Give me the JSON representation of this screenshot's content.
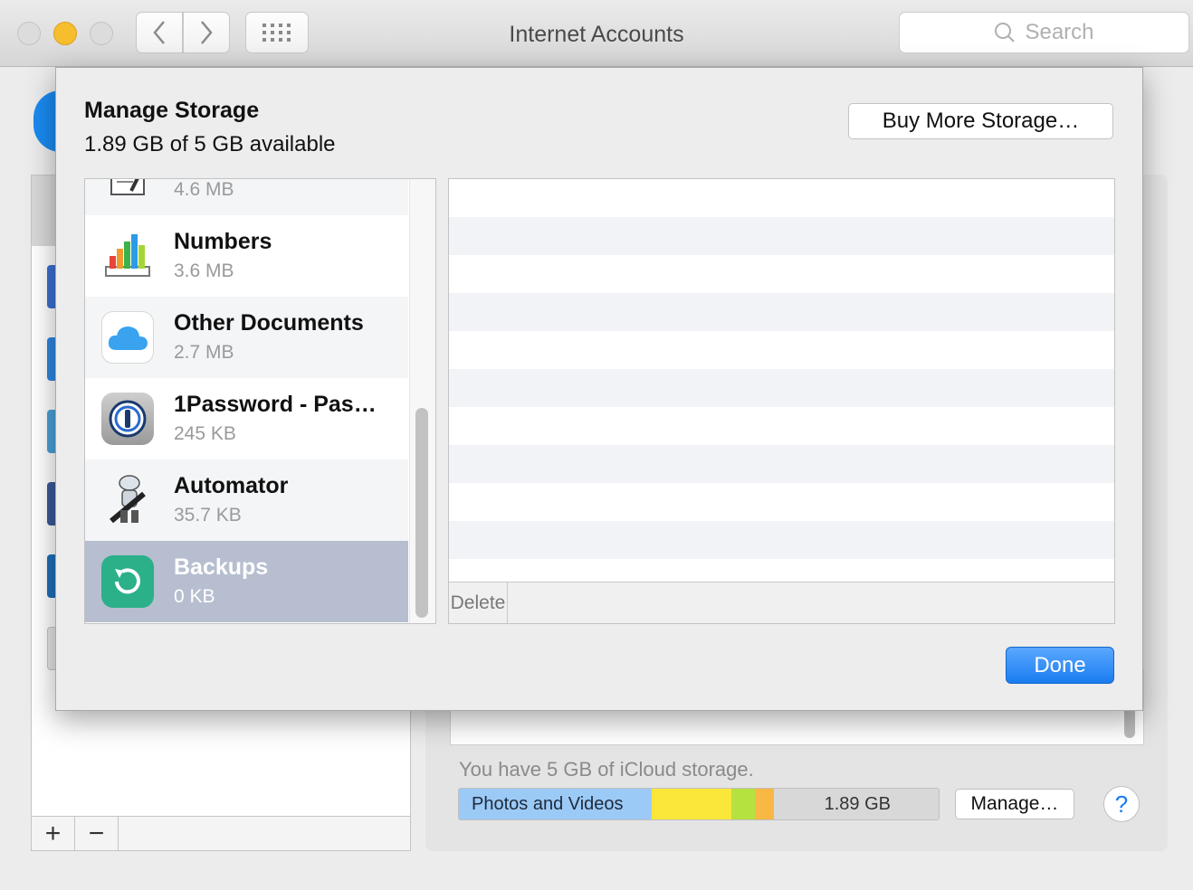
{
  "window": {
    "title": "Internet Accounts",
    "search_placeholder": "Search"
  },
  "background": {
    "storage_text": "You have 5 GB of iCloud storage.",
    "bar_label": "Photos and Videos",
    "bar_used": "1.89 GB",
    "manage_label": "Manage…",
    "help_label": "?",
    "add_label": "+",
    "remove_label": "−",
    "bar_colors": [
      "#9ccaf7",
      "#fbe63a",
      "#b5e23f",
      "#f8b843"
    ]
  },
  "sheet": {
    "title": "Manage Storage",
    "subtitle": "1.89 GB of 5 GB available",
    "buy_label": "Buy More Storage…",
    "done_label": "Done",
    "delete_label": "Delete",
    "apps": [
      {
        "name": "",
        "size": "4.6 MB",
        "icon": "textedit-icon"
      },
      {
        "name": "Numbers",
        "size": "3.6 MB",
        "icon": "numbers-icon"
      },
      {
        "name": "Other Documents",
        "size": "2.7 MB",
        "icon": "icloud-icon"
      },
      {
        "name": "1Password - Pas…",
        "size": "245 KB",
        "icon": "1password-icon"
      },
      {
        "name": "Automator",
        "size": "35.7 KB",
        "icon": "automator-icon"
      },
      {
        "name": "Backups",
        "size": "0 KB",
        "icon": "backup-icon",
        "selected": true
      }
    ]
  }
}
